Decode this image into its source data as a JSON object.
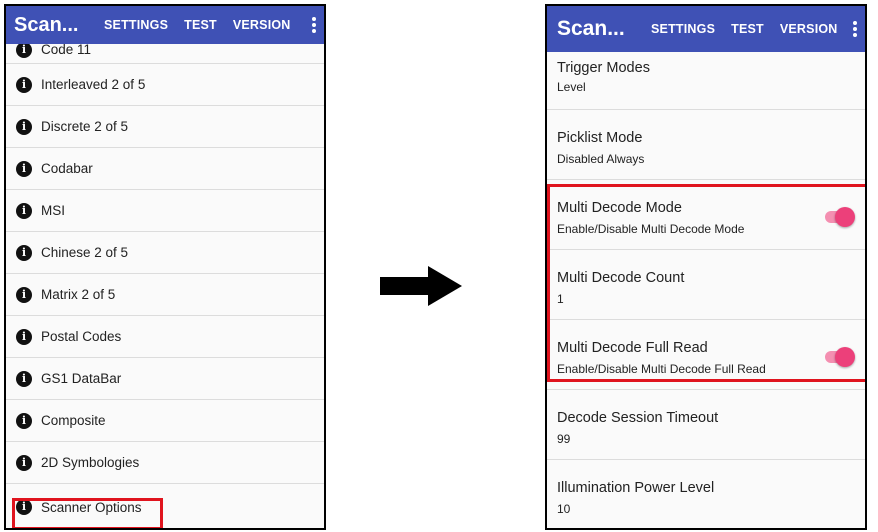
{
  "left_screen": {
    "app_title": "Scan...",
    "menu": [
      "SETTINGS",
      "TEST",
      "VERSION"
    ],
    "items": [
      "Code 11",
      "Interleaved 2 of 5",
      "Discrete 2 of 5",
      "Codabar",
      "MSI",
      "Chinese 2 of 5",
      "Matrix 2 of 5",
      "Postal Codes",
      "GS1 DataBar",
      "Composite",
      "2D Symbologies",
      "Scanner Options"
    ],
    "highlighted_item": "Scanner Options"
  },
  "right_screen": {
    "app_title": "Scan...",
    "menu": [
      "SETTINGS",
      "TEST",
      "VERSION"
    ],
    "rows": [
      {
        "title": "Trigger Modes",
        "subtitle": "Level"
      },
      {
        "title": "Picklist Mode",
        "subtitle": "Disabled Always"
      },
      {
        "title": "Multi Decode Mode",
        "subtitle": "Enable/Disable Multi Decode Mode",
        "toggle": true
      },
      {
        "title": "Multi Decode Count",
        "subtitle": "1"
      },
      {
        "title": "Multi Decode Full Read",
        "subtitle": "Enable/Disable Multi Decode Full Read",
        "toggle": true
      },
      {
        "title": "Decode Session Timeout",
        "subtitle": "99"
      },
      {
        "title": "Illumination Power Level",
        "subtitle": "10"
      }
    ]
  },
  "colors": {
    "appbar": "#3f51b5",
    "highlight": "#e0141e",
    "toggle_on": "#ec407a"
  }
}
